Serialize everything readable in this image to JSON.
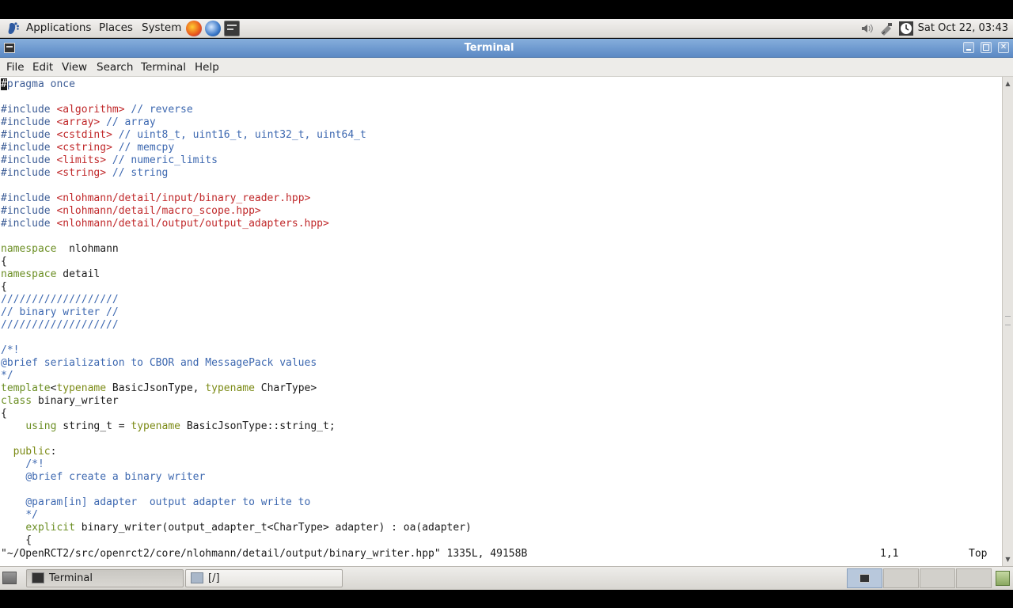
{
  "top_panel": {
    "menus": [
      "Applications",
      "Places",
      "System"
    ],
    "clock": "Sat Oct 22, 03:43"
  },
  "window": {
    "title": "Terminal",
    "menu": [
      "File",
      "Edit",
      "View",
      "Search",
      "Terminal",
      "Help"
    ]
  },
  "editor": {
    "lines": [
      [
        [
          "cur",
          "#"
        ],
        [
          "pp",
          "pragma once"
        ]
      ],
      [],
      [
        [
          "pp",
          "#include "
        ],
        [
          "str",
          "<algorithm>"
        ],
        [
          "cm",
          " // reverse"
        ]
      ],
      [
        [
          "pp",
          "#include "
        ],
        [
          "str",
          "<array>"
        ],
        [
          "cm",
          " // array"
        ]
      ],
      [
        [
          "pp",
          "#include "
        ],
        [
          "str",
          "<cstdint>"
        ],
        [
          "cm",
          " // uint8_t, uint16_t, uint32_t, uint64_t"
        ]
      ],
      [
        [
          "pp",
          "#include "
        ],
        [
          "str",
          "<cstring>"
        ],
        [
          "cm",
          " // memcpy"
        ]
      ],
      [
        [
          "pp",
          "#include "
        ],
        [
          "str",
          "<limits>"
        ],
        [
          "cm",
          " // numeric_limits"
        ]
      ],
      [
        [
          "pp",
          "#include "
        ],
        [
          "str",
          "<string>"
        ],
        [
          "cm",
          " // string"
        ]
      ],
      [],
      [
        [
          "pp",
          "#include "
        ],
        [
          "str",
          "<nlohmann/detail/input/binary_reader.hpp>"
        ]
      ],
      [
        [
          "pp",
          "#include "
        ],
        [
          "str",
          "<nlohmann/detail/macro_scope.hpp>"
        ]
      ],
      [
        [
          "pp",
          "#include "
        ],
        [
          "str",
          "<nlohmann/detail/output/output_adapters.hpp>"
        ]
      ],
      [],
      [
        [
          "kw",
          "namespace"
        ],
        [
          "",
          "  nlohmann"
        ]
      ],
      [
        [
          "",
          "{"
        ]
      ],
      [
        [
          "kw",
          "namespace"
        ],
        [
          "",
          " detail"
        ]
      ],
      [
        [
          "",
          "{"
        ]
      ],
      [
        [
          "cm",
          "///////////////////"
        ]
      ],
      [
        [
          "cm",
          "// binary writer //"
        ]
      ],
      [
        [
          "cm",
          "///////////////////"
        ]
      ],
      [],
      [
        [
          "cm",
          "/*!"
        ]
      ],
      [
        [
          "cm",
          "@brief serialization to CBOR and MessagePack values"
        ]
      ],
      [
        [
          "cm",
          "*/"
        ]
      ],
      [
        [
          "kw",
          "template"
        ],
        [
          "",
          "<"
        ],
        [
          "ty",
          "typename"
        ],
        [
          "",
          " BasicJsonType, "
        ],
        [
          "ty",
          "typename"
        ],
        [
          "",
          " CharType>"
        ]
      ],
      [
        [
          "kw",
          "class"
        ],
        [
          "",
          " binary_writer"
        ]
      ],
      [
        [
          "",
          "{"
        ]
      ],
      [
        [
          "",
          "    "
        ],
        [
          "kw",
          "using"
        ],
        [
          "",
          " string_t = "
        ],
        [
          "ty",
          "typename"
        ],
        [
          "",
          " BasicJsonType::string_t;"
        ]
      ],
      [],
      [
        [
          "",
          "  "
        ],
        [
          "ty",
          "public"
        ],
        [
          "",
          ":"
        ]
      ],
      [
        [
          "",
          "    "
        ],
        [
          "cm",
          "/*!"
        ]
      ],
      [
        [
          "",
          "    "
        ],
        [
          "cm",
          "@brief create a binary writer"
        ]
      ],
      [],
      [
        [
          "",
          "    "
        ],
        [
          "cm",
          "@param[in] adapter  output adapter to write to"
        ]
      ],
      [
        [
          "",
          "    "
        ],
        [
          "cm",
          "*/"
        ]
      ],
      [
        [
          "",
          "    "
        ],
        [
          "kw",
          "explicit"
        ],
        [
          "",
          " binary_writer(output_adapter_t<CharType> adapter) : oa(adapter)"
        ]
      ],
      [
        [
          "",
          "    {"
        ]
      ]
    ],
    "status_file": "\"~/OpenRCT2/src/openrct2/core/nlohmann/detail/output/binary_writer.hpp\" 1335L, 49158B",
    "cursor_pos": "1,1",
    "scroll_pos": "Top"
  },
  "taskbar": {
    "items": [
      "Terminal",
      "[/]"
    ]
  },
  "colors": {
    "title_bar": "#6e98cf",
    "preprocessor": "#3d5d96",
    "string": "#c0282a",
    "comment": "#3d68b0",
    "keyword": "#6b8e23"
  }
}
